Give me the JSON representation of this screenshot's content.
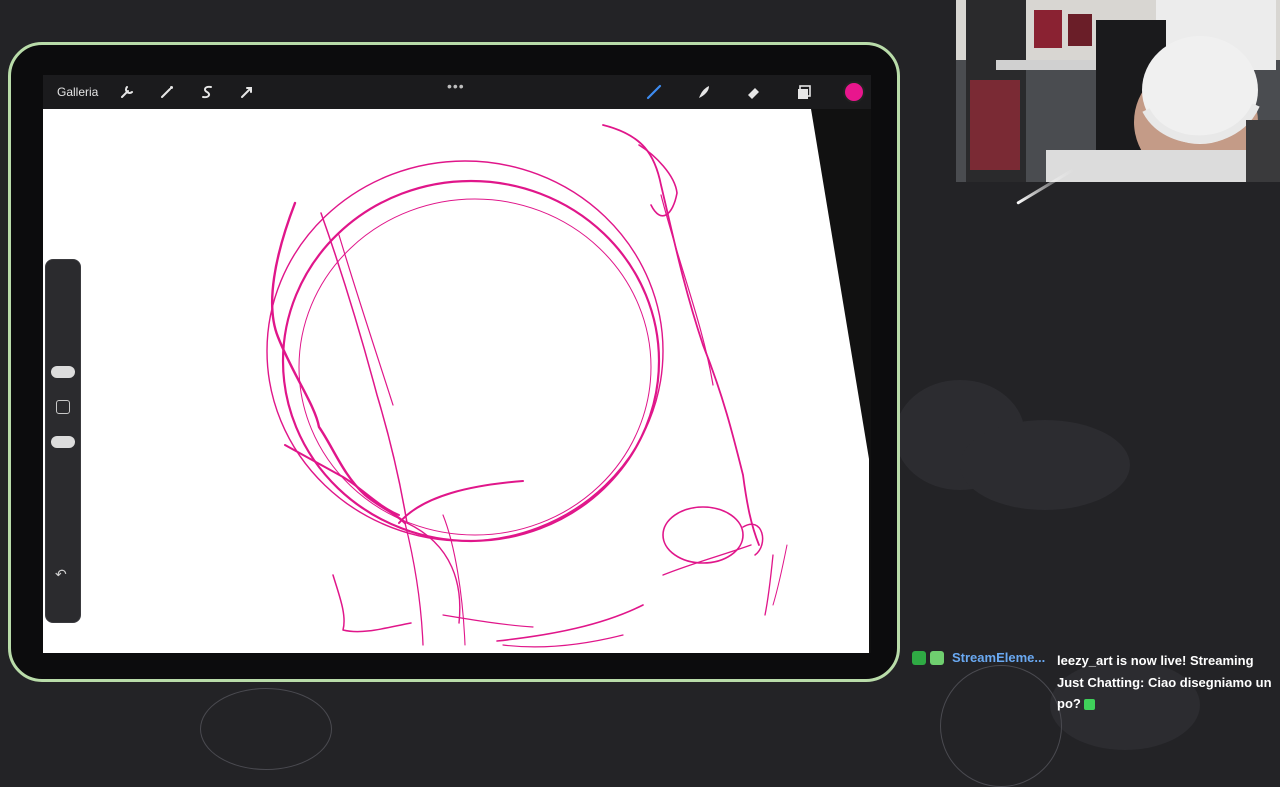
{
  "canvas_app": {
    "toolbar": {
      "gallery_label": "Galleria",
      "left_icons": [
        "wrench-icon",
        "magic-wand-icon",
        "selection-s-icon",
        "transform-arrow-icon"
      ],
      "right_icons": [
        "brush-icon",
        "smudge-icon",
        "eraser-icon",
        "layers-icon"
      ],
      "active_color": "#e8168d"
    },
    "sidebar": {
      "icons": [
        "brush-size-slider",
        "modify-square-icon",
        "opacity-slider",
        "undo-icon"
      ]
    },
    "stroke_color": "#e0168a"
  },
  "chat": {
    "username": "StreamEleme...",
    "message": "leezy_art is now live! Streaming Just Chatting: Ciao disegniamo un po?",
    "colors": {
      "username": "#6aa9f2",
      "badge_left": "#2faa44",
      "badge_right": "#6fcf6f"
    }
  },
  "theme": {
    "tablet_border": "#b9dca9",
    "page_bg": "#232326"
  }
}
